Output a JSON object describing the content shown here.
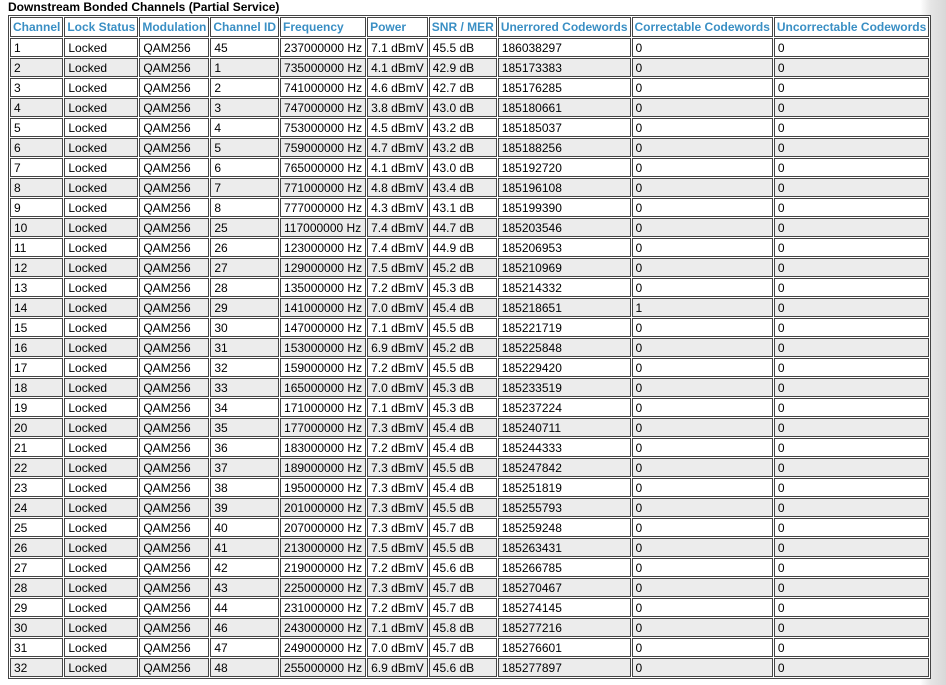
{
  "caption": "Downstream Bonded Channels (Partial Service)",
  "columns": [
    "Channel",
    "Lock Status",
    "Modulation",
    "Channel ID",
    "Frequency",
    "Power",
    "SNR / MER",
    "Unerrored Codewords",
    "Correctable Codewords",
    "Uncorrectable Codewords"
  ],
  "rows": [
    [
      "1",
      "Locked",
      "QAM256",
      "45",
      "237000000 Hz",
      "7.1 dBmV",
      "45.5 dB",
      "186038297",
      "0",
      "0"
    ],
    [
      "2",
      "Locked",
      "QAM256",
      "1",
      "735000000 Hz",
      "4.1 dBmV",
      "42.9 dB",
      "185173383",
      "0",
      "0"
    ],
    [
      "3",
      "Locked",
      "QAM256",
      "2",
      "741000000 Hz",
      "4.6 dBmV",
      "42.7 dB",
      "185176285",
      "0",
      "0"
    ],
    [
      "4",
      "Locked",
      "QAM256",
      "3",
      "747000000 Hz",
      "3.8 dBmV",
      "43.0 dB",
      "185180661",
      "0",
      "0"
    ],
    [
      "5",
      "Locked",
      "QAM256",
      "4",
      "753000000 Hz",
      "4.5 dBmV",
      "43.2 dB",
      "185185037",
      "0",
      "0"
    ],
    [
      "6",
      "Locked",
      "QAM256",
      "5",
      "759000000 Hz",
      "4.7 dBmV",
      "43.2 dB",
      "185188256",
      "0",
      "0"
    ],
    [
      "7",
      "Locked",
      "QAM256",
      "6",
      "765000000 Hz",
      "4.1 dBmV",
      "43.0 dB",
      "185192720",
      "0",
      "0"
    ],
    [
      "8",
      "Locked",
      "QAM256",
      "7",
      "771000000 Hz",
      "4.8 dBmV",
      "43.4 dB",
      "185196108",
      "0",
      "0"
    ],
    [
      "9",
      "Locked",
      "QAM256",
      "8",
      "777000000 Hz",
      "4.3 dBmV",
      "43.1 dB",
      "185199390",
      "0",
      "0"
    ],
    [
      "10",
      "Locked",
      "QAM256",
      "25",
      "117000000 Hz",
      "7.4 dBmV",
      "44.7 dB",
      "185203546",
      "0",
      "0"
    ],
    [
      "11",
      "Locked",
      "QAM256",
      "26",
      "123000000 Hz",
      "7.4 dBmV",
      "44.9 dB",
      "185206953",
      "0",
      "0"
    ],
    [
      "12",
      "Locked",
      "QAM256",
      "27",
      "129000000 Hz",
      "7.5 dBmV",
      "45.2 dB",
      "185210969",
      "0",
      "0"
    ],
    [
      "13",
      "Locked",
      "QAM256",
      "28",
      "135000000 Hz",
      "7.2 dBmV",
      "45.3 dB",
      "185214332",
      "0",
      "0"
    ],
    [
      "14",
      "Locked",
      "QAM256",
      "29",
      "141000000 Hz",
      "7.0 dBmV",
      "45.4 dB",
      "185218651",
      "1",
      "0"
    ],
    [
      "15",
      "Locked",
      "QAM256",
      "30",
      "147000000 Hz",
      "7.1 dBmV",
      "45.5 dB",
      "185221719",
      "0",
      "0"
    ],
    [
      "16",
      "Locked",
      "QAM256",
      "31",
      "153000000 Hz",
      "6.9 dBmV",
      "45.2 dB",
      "185225848",
      "0",
      "0"
    ],
    [
      "17",
      "Locked",
      "QAM256",
      "32",
      "159000000 Hz",
      "7.2 dBmV",
      "45.5 dB",
      "185229420",
      "0",
      "0"
    ],
    [
      "18",
      "Locked",
      "QAM256",
      "33",
      "165000000 Hz",
      "7.0 dBmV",
      "45.3 dB",
      "185233519",
      "0",
      "0"
    ],
    [
      "19",
      "Locked",
      "QAM256",
      "34",
      "171000000 Hz",
      "7.1 dBmV",
      "45.3 dB",
      "185237224",
      "0",
      "0"
    ],
    [
      "20",
      "Locked",
      "QAM256",
      "35",
      "177000000 Hz",
      "7.3 dBmV",
      "45.4 dB",
      "185240711",
      "0",
      "0"
    ],
    [
      "21",
      "Locked",
      "QAM256",
      "36",
      "183000000 Hz",
      "7.2 dBmV",
      "45.4 dB",
      "185244333",
      "0",
      "0"
    ],
    [
      "22",
      "Locked",
      "QAM256",
      "37",
      "189000000 Hz",
      "7.3 dBmV",
      "45.5 dB",
      "185247842",
      "0",
      "0"
    ],
    [
      "23",
      "Locked",
      "QAM256",
      "38",
      "195000000 Hz",
      "7.3 dBmV",
      "45.4 dB",
      "185251819",
      "0",
      "0"
    ],
    [
      "24",
      "Locked",
      "QAM256",
      "39",
      "201000000 Hz",
      "7.3 dBmV",
      "45.5 dB",
      "185255793",
      "0",
      "0"
    ],
    [
      "25",
      "Locked",
      "QAM256",
      "40",
      "207000000 Hz",
      "7.3 dBmV",
      "45.7 dB",
      "185259248",
      "0",
      "0"
    ],
    [
      "26",
      "Locked",
      "QAM256",
      "41",
      "213000000 Hz",
      "7.5 dBmV",
      "45.5 dB",
      "185263431",
      "0",
      "0"
    ],
    [
      "27",
      "Locked",
      "QAM256",
      "42",
      "219000000 Hz",
      "7.2 dBmV",
      "45.6 dB",
      "185266785",
      "0",
      "0"
    ],
    [
      "28",
      "Locked",
      "QAM256",
      "43",
      "225000000 Hz",
      "7.3 dBmV",
      "45.7 dB",
      "185270467",
      "0",
      "0"
    ],
    [
      "29",
      "Locked",
      "QAM256",
      "44",
      "231000000 Hz",
      "7.2 dBmV",
      "45.7 dB",
      "185274145",
      "0",
      "0"
    ],
    [
      "30",
      "Locked",
      "QAM256",
      "46",
      "243000000 Hz",
      "7.1 dBmV",
      "45.8 dB",
      "185277216",
      "0",
      "0"
    ],
    [
      "31",
      "Locked",
      "QAM256",
      "47",
      "249000000 Hz",
      "7.0 dBmV",
      "45.7 dB",
      "185276601",
      "0",
      "0"
    ],
    [
      "32",
      "Locked",
      "QAM256",
      "48",
      "255000000 Hz",
      "6.9 dBmV",
      "45.6 dB",
      "185277897",
      "0",
      "0"
    ]
  ],
  "colors": {
    "header_text": "#3a8fc4",
    "row_alt": "#ececec",
    "border": "#444444"
  }
}
